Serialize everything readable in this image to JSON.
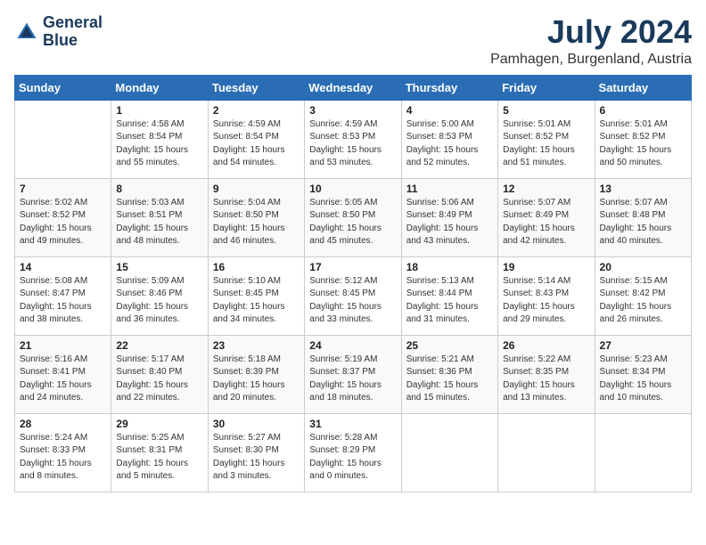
{
  "header": {
    "logo_line1": "General",
    "logo_line2": "Blue",
    "month_year": "July 2024",
    "location": "Pamhagen, Burgenland, Austria"
  },
  "days_of_week": [
    "Sunday",
    "Monday",
    "Tuesday",
    "Wednesday",
    "Thursday",
    "Friday",
    "Saturday"
  ],
  "weeks": [
    [
      {
        "day": "",
        "content": ""
      },
      {
        "day": "1",
        "content": "Sunrise: 4:58 AM\nSunset: 8:54 PM\nDaylight: 15 hours\nand 55 minutes."
      },
      {
        "day": "2",
        "content": "Sunrise: 4:59 AM\nSunset: 8:54 PM\nDaylight: 15 hours\nand 54 minutes."
      },
      {
        "day": "3",
        "content": "Sunrise: 4:59 AM\nSunset: 8:53 PM\nDaylight: 15 hours\nand 53 minutes."
      },
      {
        "day": "4",
        "content": "Sunrise: 5:00 AM\nSunset: 8:53 PM\nDaylight: 15 hours\nand 52 minutes."
      },
      {
        "day": "5",
        "content": "Sunrise: 5:01 AM\nSunset: 8:52 PM\nDaylight: 15 hours\nand 51 minutes."
      },
      {
        "day": "6",
        "content": "Sunrise: 5:01 AM\nSunset: 8:52 PM\nDaylight: 15 hours\nand 50 minutes."
      }
    ],
    [
      {
        "day": "7",
        "content": "Sunrise: 5:02 AM\nSunset: 8:52 PM\nDaylight: 15 hours\nand 49 minutes."
      },
      {
        "day": "8",
        "content": "Sunrise: 5:03 AM\nSunset: 8:51 PM\nDaylight: 15 hours\nand 48 minutes."
      },
      {
        "day": "9",
        "content": "Sunrise: 5:04 AM\nSunset: 8:50 PM\nDaylight: 15 hours\nand 46 minutes."
      },
      {
        "day": "10",
        "content": "Sunrise: 5:05 AM\nSunset: 8:50 PM\nDaylight: 15 hours\nand 45 minutes."
      },
      {
        "day": "11",
        "content": "Sunrise: 5:06 AM\nSunset: 8:49 PM\nDaylight: 15 hours\nand 43 minutes."
      },
      {
        "day": "12",
        "content": "Sunrise: 5:07 AM\nSunset: 8:49 PM\nDaylight: 15 hours\nand 42 minutes."
      },
      {
        "day": "13",
        "content": "Sunrise: 5:07 AM\nSunset: 8:48 PM\nDaylight: 15 hours\nand 40 minutes."
      }
    ],
    [
      {
        "day": "14",
        "content": "Sunrise: 5:08 AM\nSunset: 8:47 PM\nDaylight: 15 hours\nand 38 minutes."
      },
      {
        "day": "15",
        "content": "Sunrise: 5:09 AM\nSunset: 8:46 PM\nDaylight: 15 hours\nand 36 minutes."
      },
      {
        "day": "16",
        "content": "Sunrise: 5:10 AM\nSunset: 8:45 PM\nDaylight: 15 hours\nand 34 minutes."
      },
      {
        "day": "17",
        "content": "Sunrise: 5:12 AM\nSunset: 8:45 PM\nDaylight: 15 hours\nand 33 minutes."
      },
      {
        "day": "18",
        "content": "Sunrise: 5:13 AM\nSunset: 8:44 PM\nDaylight: 15 hours\nand 31 minutes."
      },
      {
        "day": "19",
        "content": "Sunrise: 5:14 AM\nSunset: 8:43 PM\nDaylight: 15 hours\nand 29 minutes."
      },
      {
        "day": "20",
        "content": "Sunrise: 5:15 AM\nSunset: 8:42 PM\nDaylight: 15 hours\nand 26 minutes."
      }
    ],
    [
      {
        "day": "21",
        "content": "Sunrise: 5:16 AM\nSunset: 8:41 PM\nDaylight: 15 hours\nand 24 minutes."
      },
      {
        "day": "22",
        "content": "Sunrise: 5:17 AM\nSunset: 8:40 PM\nDaylight: 15 hours\nand 22 minutes."
      },
      {
        "day": "23",
        "content": "Sunrise: 5:18 AM\nSunset: 8:39 PM\nDaylight: 15 hours\nand 20 minutes."
      },
      {
        "day": "24",
        "content": "Sunrise: 5:19 AM\nSunset: 8:37 PM\nDaylight: 15 hours\nand 18 minutes."
      },
      {
        "day": "25",
        "content": "Sunrise: 5:21 AM\nSunset: 8:36 PM\nDaylight: 15 hours\nand 15 minutes."
      },
      {
        "day": "26",
        "content": "Sunrise: 5:22 AM\nSunset: 8:35 PM\nDaylight: 15 hours\nand 13 minutes."
      },
      {
        "day": "27",
        "content": "Sunrise: 5:23 AM\nSunset: 8:34 PM\nDaylight: 15 hours\nand 10 minutes."
      }
    ],
    [
      {
        "day": "28",
        "content": "Sunrise: 5:24 AM\nSunset: 8:33 PM\nDaylight: 15 hours\nand 8 minutes."
      },
      {
        "day": "29",
        "content": "Sunrise: 5:25 AM\nSunset: 8:31 PM\nDaylight: 15 hours\nand 5 minutes."
      },
      {
        "day": "30",
        "content": "Sunrise: 5:27 AM\nSunset: 8:30 PM\nDaylight: 15 hours\nand 3 minutes."
      },
      {
        "day": "31",
        "content": "Sunrise: 5:28 AM\nSunset: 8:29 PM\nDaylight: 15 hours\nand 0 minutes."
      },
      {
        "day": "",
        "content": ""
      },
      {
        "day": "",
        "content": ""
      },
      {
        "day": "",
        "content": ""
      }
    ]
  ]
}
